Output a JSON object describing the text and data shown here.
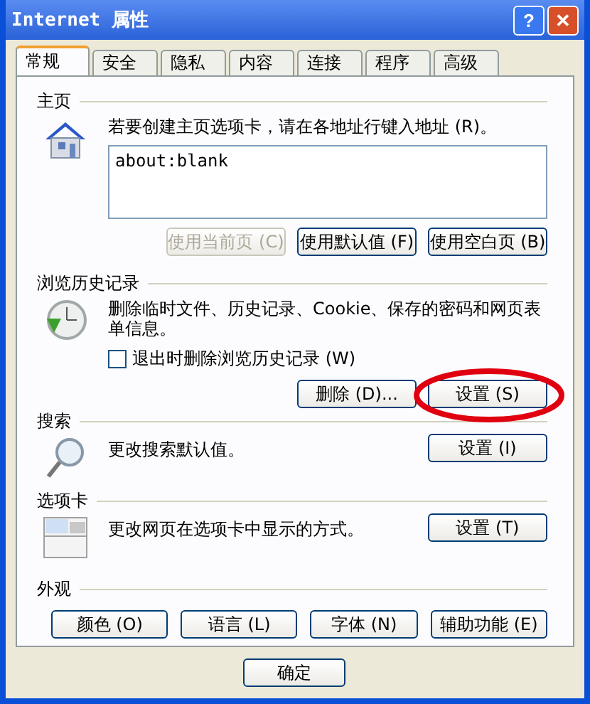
{
  "window": {
    "title": "Internet 属性",
    "buttons": [
      {
        "kind": "help",
        "label": "?"
      },
      {
        "kind": "close",
        "label": "✕"
      }
    ]
  },
  "tabs": [
    {
      "label": "常规",
      "selected": true
    },
    {
      "label": "安全",
      "selected": false
    },
    {
      "label": "隐私",
      "selected": false
    },
    {
      "label": "内容",
      "selected": false
    },
    {
      "label": "连接",
      "selected": false
    },
    {
      "label": "程序",
      "selected": false
    },
    {
      "label": "高级",
      "selected": false
    }
  ],
  "home": {
    "title": "主页",
    "hint": "若要创建主页选项卡，请在各地址行键入地址 (R)。",
    "value": "about:blank",
    "buttons": [
      {
        "label": "使用当前页 (C)",
        "disabled": true
      },
      {
        "label": "使用默认值 (F)",
        "disabled": false
      },
      {
        "label": "使用空白页 (B)",
        "disabled": false
      }
    ]
  },
  "history": {
    "title": "浏览历史记录",
    "text": "删除临时文件、历史记录、Cookie、保存的密码和网页表单信息。",
    "checkbox": {
      "label": "退出时删除浏览历史记录 (W)",
      "checked": false
    },
    "buttons": [
      {
        "label": "删除 (D)...",
        "circled": false
      },
      {
        "label": "设置 (S)",
        "circled": true
      }
    ]
  },
  "search": {
    "title": "搜索",
    "text": "更改搜索默认值。",
    "button": "设置 (I)"
  },
  "tabs_section": {
    "title": "选项卡",
    "text": "更改网页在选项卡中显示的方式。",
    "button": "设置 (T)"
  },
  "appearance": {
    "title": "外观",
    "buttons": [
      "颜色 (O)",
      "语言 (L)",
      "字体 (N)",
      "辅助功能 (E)"
    ]
  },
  "footer": {
    "buttons": [
      "确定"
    ]
  }
}
